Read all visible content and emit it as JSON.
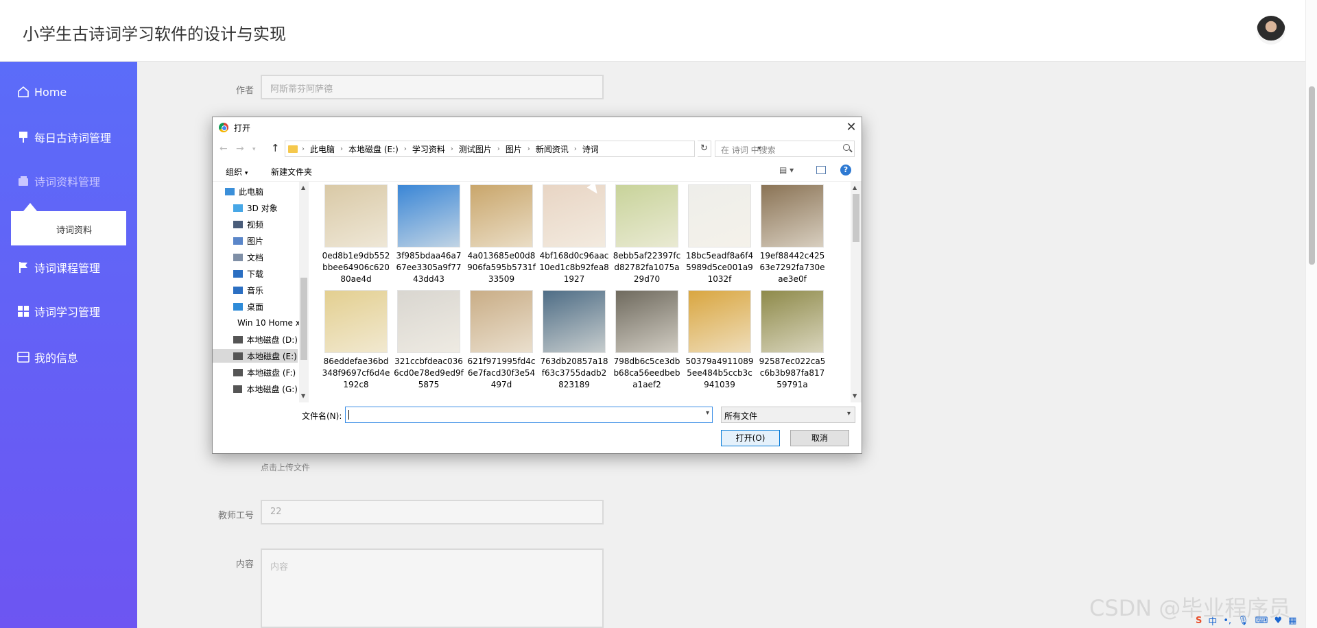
{
  "app": {
    "title": "小学生古诗词学习软件的设计与实现"
  },
  "sidebar": {
    "items": [
      {
        "label": "Home",
        "icon": "home-icon"
      },
      {
        "label": "每日古诗词管理",
        "icon": "pin-icon"
      },
      {
        "label": "诗词资料管理",
        "icon": "wallet-icon"
      },
      {
        "label": "诗词课程管理",
        "icon": "flag-icon"
      },
      {
        "label": "诗词学习管理",
        "icon": "grid-icon"
      },
      {
        "label": "我的信息",
        "icon": "card-icon"
      }
    ],
    "submenu": {
      "label": "诗词资料"
    }
  },
  "form": {
    "author_label": "作者",
    "author_value": "阿斯蒂芬阿萨德",
    "upload_hint": "点击上传文件",
    "teacher_label": "教师工号",
    "teacher_value": "22",
    "content_label": "内容",
    "content_placeholder": "内容"
  },
  "dialog": {
    "title": "打开",
    "breadcrumb": [
      "此电脑",
      "本地磁盘 (E:)",
      "学习资料",
      "测试图片",
      "图片",
      "新闻资讯",
      "诗词"
    ],
    "search_placeholder": "在 诗词 中搜索",
    "toolbar": {
      "organize": "组织",
      "new_folder": "新建文件夹"
    },
    "tree": [
      {
        "label": "此电脑",
        "icon": "computer-icon",
        "color": "#3b8fd9"
      },
      {
        "label": "3D 对象",
        "icon": "cube-icon",
        "color": "#47a7e6"
      },
      {
        "label": "视频",
        "icon": "video-icon",
        "color": "#4a5d7a"
      },
      {
        "label": "图片",
        "icon": "picture-icon",
        "color": "#5a86c9"
      },
      {
        "label": "文档",
        "icon": "document-icon",
        "color": "#7f8fa6"
      },
      {
        "label": "下载",
        "icon": "download-icon",
        "color": "#2b6fc2"
      },
      {
        "label": "音乐",
        "icon": "music-icon",
        "color": "#2b6fc2"
      },
      {
        "label": "桌面",
        "icon": "desktop-icon",
        "color": "#2e8bd8"
      },
      {
        "label": "Win 10 Home x",
        "icon": "drive-icon",
        "color": "#555555"
      },
      {
        "label": "本地磁盘 (D:)",
        "icon": "drive-icon",
        "color": "#555555"
      },
      {
        "label": "本地磁盘 (E:)",
        "icon": "drive-icon",
        "color": "#555555"
      },
      {
        "label": "本地磁盘 (F:)",
        "icon": "drive-icon",
        "color": "#555555"
      },
      {
        "label": "本地磁盘 (G:)",
        "icon": "drive-icon",
        "color": "#555555"
      }
    ],
    "files": [
      {
        "name": "0ed8b1e9db552bbee64906c62080ae4d",
        "bg": "#d9c9a6"
      },
      {
        "name": "3f985bdaa46a767ee3305a9f7743dd43",
        "bg": "#3a86d6"
      },
      {
        "name": "4a013685e00d8906fa595b5731f33509",
        "bg": "#c9a66b"
      },
      {
        "name": "4bf168d0c96aac10ed1c8b92fea81927",
        "bg": "#e8d5c4"
      },
      {
        "name": "8ebb5af22397fcd82782fa1075a29d70",
        "bg": "#c8d39a"
      },
      {
        "name": "18bc5eadf8a6f45989d5ce001a91032f",
        "bg": "#eeeeea"
      },
      {
        "name": "19ef88442c42563e7292fa730eae3e0f",
        "bg": "#8a7355"
      },
      {
        "name": "86eddefae36bd348f9697cf6d4e192c8",
        "bg": "#e3cf90"
      },
      {
        "name": "321ccbfdeac0366cd0e78ed9ed9f5875",
        "bg": "#d9d6d0"
      },
      {
        "name": "621f971995fd4c6e7facd30f3e54497d",
        "bg": "#c9ad86"
      },
      {
        "name": "763db20857a18f63c3755dadb2823189",
        "bg": "#4e6d86"
      },
      {
        "name": "798db6c5ce3dbb68ca56eedbeba1aef2",
        "bg": "#6f6a5e"
      },
      {
        "name": "50379a49110895ee484b5ccb3c941039",
        "bg": "#d9a640"
      },
      {
        "name": "92587ec022ca5c6b3b987fa81759791a",
        "bg": "#8e8a4a"
      }
    ],
    "filename_label": "文件名(N):",
    "filename_value": "",
    "filter": "所有文件",
    "open_button": "打开(O)",
    "cancel_button": "取消"
  },
  "watermark": "CSDN @毕业程序员",
  "tray": {
    "ime": "S",
    "lang": "中"
  }
}
